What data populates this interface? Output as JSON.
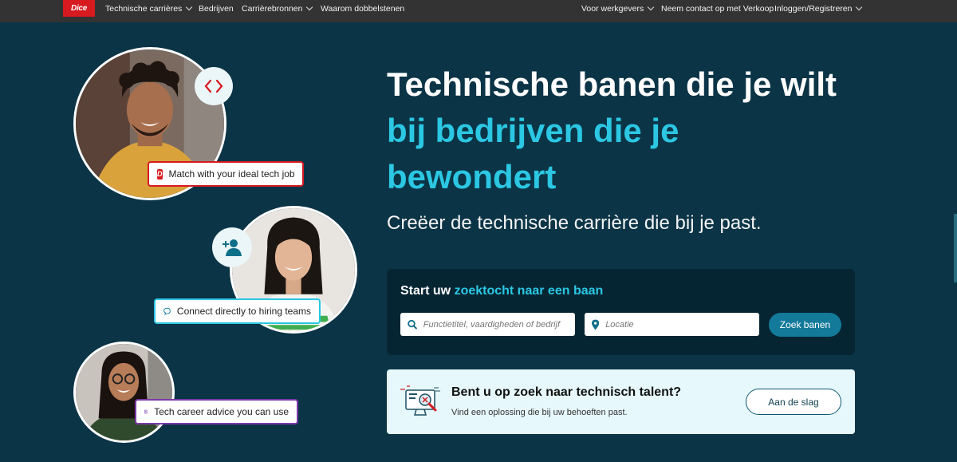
{
  "nav": {
    "logo": "Dice",
    "left": [
      {
        "label": "Technische carrières",
        "dropdown": true
      },
      {
        "label": "Bedrijven",
        "dropdown": false
      },
      {
        "label": "Carrièrebronnen",
        "dropdown": true
      },
      {
        "label": "Waarom dobbelstenen",
        "dropdown": false
      }
    ],
    "right": [
      {
        "label": "Voor werkgevers",
        "dropdown": true
      },
      {
        "label": "Neem contact op met Verkoop",
        "dropdown": false
      },
      {
        "label": "Inloggen/Registreren",
        "dropdown": true
      }
    ]
  },
  "hero": {
    "line1": "Technische banen die je wilt",
    "line2": "bij bedrijven die je",
    "line3": "bewondert",
    "subtitle": "Creëer de technische carrière die bij je past."
  },
  "features": {
    "match": "Match with your ideal tech job",
    "connect": "Connect directly to hiring teams",
    "advice": "Tech career advice you can use"
  },
  "search": {
    "title_prefix": "Start uw ",
    "title_highlight": "zoektocht naar een baan",
    "keyword_placeholder": "Functietitel, vaardigheden of bedrijf",
    "location_placeholder": "Locatie",
    "button": "Zoek banen"
  },
  "talent": {
    "title": "Bent u op zoek naar technisch talent?",
    "subtitle": "Vind een oplossing die bij uw behoeften past.",
    "button": "Aan de slag"
  },
  "colors": {
    "background": "#0b3446",
    "accent_cyan": "#2bc7e3",
    "nav_bg": "#333333",
    "brand_red": "#d71920",
    "button_teal": "#137a9a"
  }
}
